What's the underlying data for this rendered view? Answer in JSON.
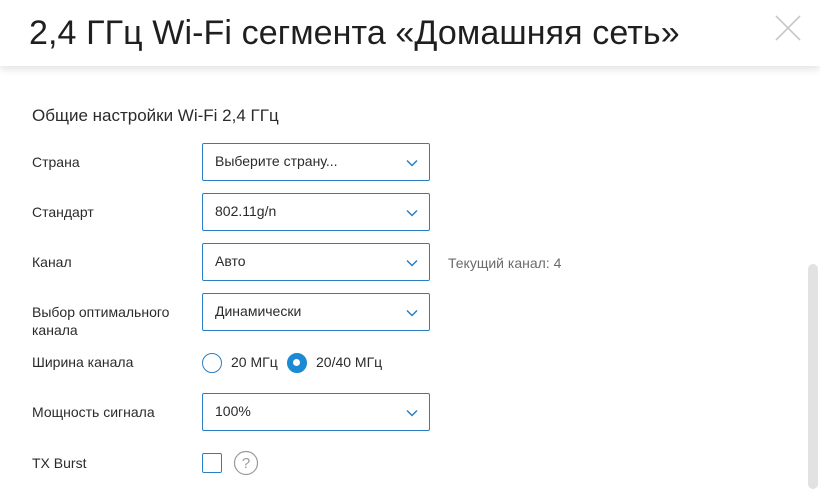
{
  "header": {
    "title": "2,4 ГГц Wi-Fi сегмента «Домашняя сеть»",
    "close_icon": "close-icon"
  },
  "section": {
    "title": "Общие настройки Wi-Fi 2,4 ГГц"
  },
  "fields": {
    "country": {
      "label": "Страна",
      "value": "Выберите страну..."
    },
    "standard": {
      "label": "Стандарт",
      "value": "802.11g/n"
    },
    "channel": {
      "label": "Канал",
      "value": "Авто",
      "hint": "Текущий канал: 4"
    },
    "optimal_channel": {
      "label": "Выбор оптимального канала",
      "value": "Динамически"
    },
    "channel_width": {
      "label": "Ширина канала",
      "options": [
        "20 МГц",
        "20/40 МГц"
      ],
      "selected": "20/40 МГц"
    },
    "signal_power": {
      "label": "Мощность сигнала",
      "value": "100%"
    },
    "tx_burst": {
      "label": "TX Burst",
      "checked": false
    }
  },
  "colors": {
    "accent": "#2a7fc4",
    "radio_selected": "#1a8ad4"
  }
}
